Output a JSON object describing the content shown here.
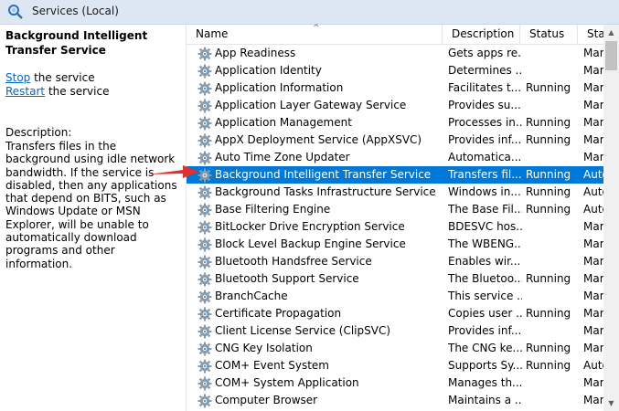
{
  "window": {
    "title": "Services (Local)",
    "icon": "gear-magnifier-icon"
  },
  "detail": {
    "service_name": "Background Intelligent Transfer Service",
    "stop_link": "Stop",
    "stop_suffix": " the service",
    "restart_link": "Restart",
    "restart_suffix": " the service",
    "description_label": "Description:",
    "description": "Transfers files in the background using idle network bandwidth. If the service is disabled, then any applications that depend on BITS, such as Windows Update or MSN Explorer, will be unable to automatically download programs and other information."
  },
  "columns": {
    "name": "Name",
    "description": "Description",
    "status": "Status",
    "startup": "Star"
  },
  "rows": [
    {
      "name": "App Readiness",
      "description": "Gets apps re...",
      "status": "",
      "startup": "Mar"
    },
    {
      "name": "Application Identity",
      "description": "Determines ...",
      "status": "",
      "startup": "Mar"
    },
    {
      "name": "Application Information",
      "description": "Facilitates t...",
      "status": "Running",
      "startup": "Mar"
    },
    {
      "name": "Application Layer Gateway Service",
      "description": "Provides su...",
      "status": "",
      "startup": "Mar"
    },
    {
      "name": "Application Management",
      "description": "Processes in...",
      "status": "Running",
      "startup": "Mar"
    },
    {
      "name": "AppX Deployment Service (AppXSVC)",
      "description": "Provides inf...",
      "status": "Running",
      "startup": "Mar"
    },
    {
      "name": "Auto Time Zone Updater",
      "description": "Automatica...",
      "status": "",
      "startup": "Mar"
    },
    {
      "name": "Background Intelligent Transfer Service",
      "description": "Transfers fil...",
      "status": "Running",
      "startup": "Auto",
      "selected": true
    },
    {
      "name": "Background Tasks Infrastructure Service",
      "description": "Windows in...",
      "status": "Running",
      "startup": "Auto"
    },
    {
      "name": "Base Filtering Engine",
      "description": "The Base Fil...",
      "status": "Running",
      "startup": "Auto"
    },
    {
      "name": "BitLocker Drive Encryption Service",
      "description": "BDESVC hos...",
      "status": "",
      "startup": "Mar"
    },
    {
      "name": "Block Level Backup Engine Service",
      "description": "The WBENG...",
      "status": "",
      "startup": "Mar"
    },
    {
      "name": "Bluetooth Handsfree Service",
      "description": "Enables wir...",
      "status": "",
      "startup": "Mar"
    },
    {
      "name": "Bluetooth Support Service",
      "description": "The Bluetoo...",
      "status": "Running",
      "startup": "Mar"
    },
    {
      "name": "BranchCache",
      "description": "This service ...",
      "status": "",
      "startup": "Mar"
    },
    {
      "name": "Certificate Propagation",
      "description": "Copies user ...",
      "status": "Running",
      "startup": "Mar"
    },
    {
      "name": "Client License Service (ClipSVC)",
      "description": "Provides inf...",
      "status": "",
      "startup": "Mar"
    },
    {
      "name": "CNG Key Isolation",
      "description": "The CNG ke...",
      "status": "Running",
      "startup": "Mar"
    },
    {
      "name": "COM+ Event System",
      "description": "Supports Sy...",
      "status": "Running",
      "startup": "Auto"
    },
    {
      "name": "COM+ System Application",
      "description": "Manages th...",
      "status": "",
      "startup": "Mar"
    },
    {
      "name": "Computer Browser",
      "description": "Maintains a ...",
      "status": "",
      "startup": "Mar"
    }
  ],
  "row_icon": "gear-icon",
  "colors": {
    "selection": "#0078d7",
    "link": "#0066cc",
    "annotation": "#e03030"
  }
}
